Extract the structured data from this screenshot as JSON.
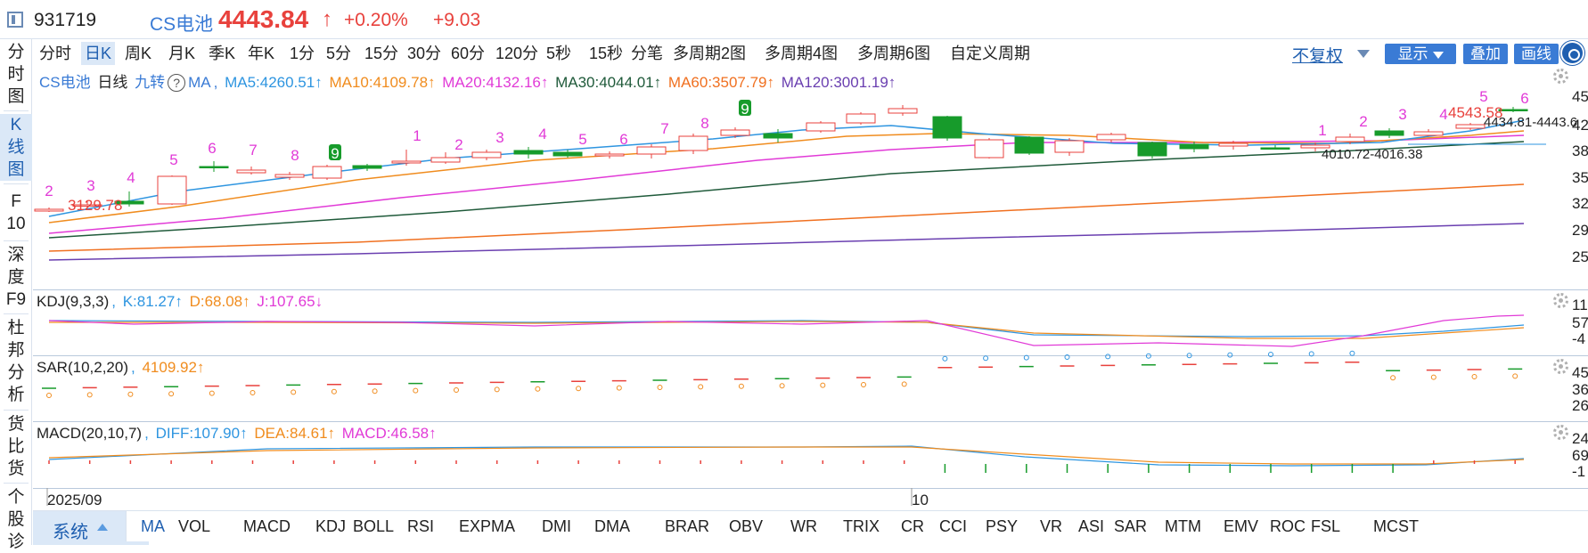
{
  "header": {
    "code": "931719",
    "name": "CS电池",
    "price": "4443.84",
    "price_arrow": "↑",
    "change_pct": "+0.20%",
    "change_abs": "+9.03"
  },
  "left_nav": [
    {
      "label": "分时图"
    },
    {
      "label": "K线图"
    },
    {
      "label": "F10"
    },
    {
      "label": "深度F9"
    },
    {
      "label": "杜邦分析"
    },
    {
      "label": "货比货"
    },
    {
      "label": "个股诊"
    }
  ],
  "periods": [
    "分时",
    "日K",
    "周K",
    "月K",
    "季K",
    "年K",
    "1分",
    "5分",
    "15分",
    "30分",
    "60分",
    "120分",
    "5秒",
    "15秒",
    "分笔",
    "多周期2图",
    "多周期4图",
    "多周期6图",
    "自定义周期"
  ],
  "active_period": "日K",
  "toolbar": {
    "restore_label": "不复权",
    "display_label": "显示",
    "overlay_label": "叠加",
    "draw_label": "画线"
  },
  "main_header": {
    "name": "CS电池",
    "period": "日线",
    "nine": "九转",
    "help": "?",
    "ma_label": "MA",
    "ma5": "MA5:4260.51↑",
    "ma10": "MA10:4109.78↑",
    "ma20": "MA20:4132.16↑",
    "ma30": "MA30:4044.01↑",
    "ma60": "MA60:3507.79↑",
    "ma120": "MA120:3001.19↑"
  },
  "main_annotations": {
    "low_label": "3129.78",
    "range_label": "4010.72-4016.38",
    "high_label": "4543.58",
    "last_range_label": "4434.81-4443.6"
  },
  "nine_turn_labels": [
    "2",
    "3",
    "4",
    "5",
    "6",
    "7",
    "8",
    "9",
    "1",
    "2",
    "3",
    "4",
    "5",
    "6",
    "7",
    "8",
    "9",
    "1",
    "2",
    "3",
    "4",
    "5",
    "6"
  ],
  "y_axis": {
    "main": [
      "45",
      "42",
      "38",
      "35",
      "32",
      "29",
      "25"
    ],
    "kdj": [
      "11",
      "57",
      "-4"
    ],
    "sar": [
      "45",
      "36",
      "26"
    ],
    "macd": [
      "24",
      "69",
      "-1"
    ]
  },
  "kdj_header": {
    "label": "KDJ(9,3,3)",
    "k": "K:81.27↑",
    "d": "D:68.08↑",
    "j": "J:107.65↓"
  },
  "sar_header": {
    "label": "SAR(10,2,20)",
    "value": "4109.92↑"
  },
  "macd_header": {
    "label": "MACD(20,10,7)",
    "diff": "DIFF:107.90↑",
    "dea": "DEA:84.61↑",
    "macd": "MACD:46.58↑"
  },
  "x_axis": {
    "start": "2025/09",
    "mid": "10"
  },
  "bottom_tabs": [
    "MA",
    "VOL",
    "MACD",
    "KDJ",
    "BOLL",
    "RSI",
    "EXPMA",
    "DMI",
    "DMA",
    "BRAR",
    "OBV",
    "WR",
    "TRIX",
    "CR",
    "CCI",
    "PSY",
    "VR",
    "ASI",
    "SAR",
    "MTM",
    "EMV",
    "ROC",
    "FSL",
    "MCST"
  ],
  "bottom_system_label": "系统",
  "colors": {
    "up": "#e8413c",
    "down": "#179b2b",
    "ma5": "#2e95e0",
    "ma10": "#f08c1e",
    "ma20": "#e13ad7",
    "ma30": "#1f5a3a",
    "ma60": "#f07020",
    "ma120": "#6a3fb0",
    "accent": "#1f5fb0"
  }
}
